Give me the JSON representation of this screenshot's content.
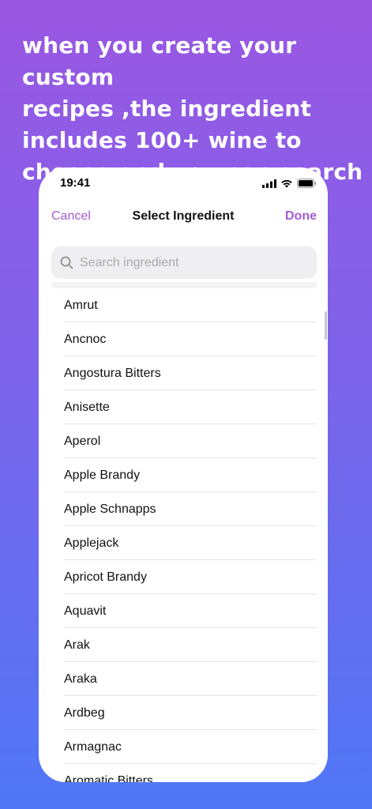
{
  "promo": {
    "line1": "when you create your custom",
    "line2": "recipes ,the ingredient",
    "line3": "includes 100+ wine to",
    "line4": "choose and you can search"
  },
  "status_bar": {
    "time": "19:41",
    "icons": [
      "cellular-signal-icon",
      "wifi-icon",
      "battery-icon"
    ]
  },
  "nav": {
    "cancel_label": "Cancel",
    "title": "Select Ingredient",
    "done_label": "Done"
  },
  "search": {
    "placeholder": "Search ingredient",
    "value": ""
  },
  "ingredients": [
    "Amrut",
    "Ancnoc",
    "Angostura Bitters",
    "Anisette",
    "Aperol",
    "Apple Brandy",
    "Apple Schnapps",
    "Applejack",
    "Apricot Brandy",
    "Aquavit",
    "Arak",
    "Araka",
    "Ardbeg",
    "Armagnac",
    "Aromatic Bitters"
  ],
  "colors": {
    "accent": "#a35cd6",
    "gradient_top": "#9a57e2",
    "gradient_bottom": "#4f77f6"
  }
}
